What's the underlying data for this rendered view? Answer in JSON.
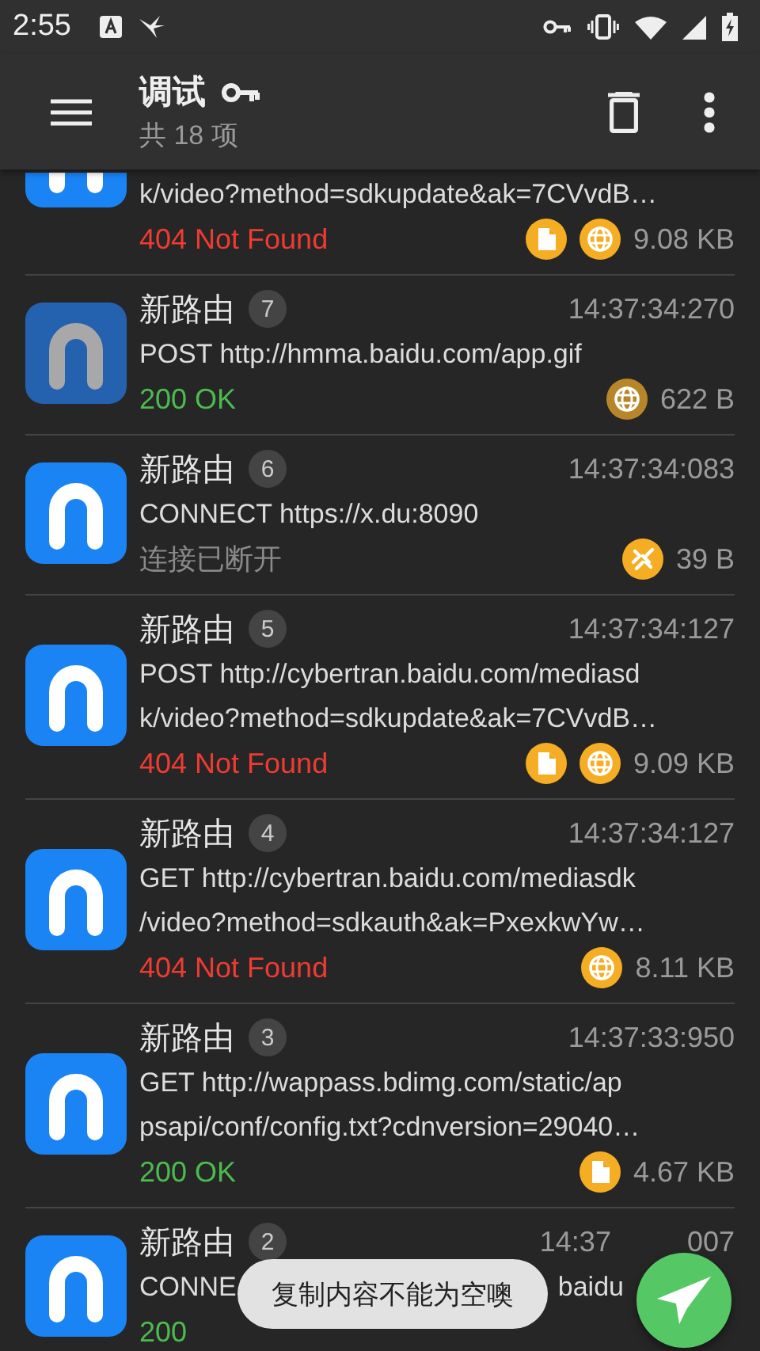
{
  "status_bar": {
    "time": "2:55"
  },
  "app_bar": {
    "title": "调试",
    "subtitle": "共 18 项"
  },
  "requests": [
    {
      "dimmed": false,
      "url_lines": [
        "k/video?method=sdkupdate&ak=7CVvdB…"
      ],
      "status": "404 Not Found",
      "color": "#ef3b32",
      "badges": [
        {
          "kind": "file",
          "dimmed": false
        },
        {
          "kind": "globe",
          "dimmed": false
        }
      ],
      "size": "9.08 KB"
    },
    {
      "dimmed": true,
      "name": "新路由",
      "number": "7",
      "time": "14:37:34:270",
      "url_lines": [
        "POST http://hmma.baidu.com/app.gif"
      ],
      "status": "200 OK",
      "color": "#4cbb4f",
      "badges": [
        {
          "kind": "globe",
          "dimmed": true
        }
      ],
      "size": "622 B"
    },
    {
      "dimmed": false,
      "name": "新路由",
      "number": "6",
      "time": "14:37:34:083",
      "url_lines": [
        "CONNECT https://x.du:8090"
      ],
      "status": "连接已断开",
      "color": "#8a8a8a",
      "badges": [
        {
          "kind": "broken-link",
          "dimmed": false
        }
      ],
      "size": "39 B"
    },
    {
      "dimmed": false,
      "name": "新路由",
      "number": "5",
      "time": "14:37:34:127",
      "url_lines": [
        "POST http://cybertran.baidu.com/mediasd",
        "k/video?method=sdkupdate&ak=7CVvdB…"
      ],
      "status": "404 Not Found",
      "color": "#ef3b32",
      "badges": [
        {
          "kind": "file",
          "dimmed": false
        },
        {
          "kind": "globe",
          "dimmed": false
        }
      ],
      "size": "9.09 KB"
    },
    {
      "dimmed": false,
      "name": "新路由",
      "number": "4",
      "time": "14:37:34:127",
      "url_lines": [
        "GET http://cybertran.baidu.com/mediasdk",
        "/video?method=sdkauth&ak=PxexkwYw…"
      ],
      "status": "404 Not Found",
      "color": "#ef3b32",
      "badges": [
        {
          "kind": "globe",
          "dimmed": false
        }
      ],
      "size": "8.11 KB"
    },
    {
      "dimmed": false,
      "name": "新路由",
      "number": "3",
      "time": "14:37:33:950",
      "url_lines": [
        "GET http://wappass.bdimg.com/static/ap",
        "psapi/conf/config.txt?cdnversion=29040…"
      ],
      "status": "200 OK",
      "color": "#4cbb4f",
      "badges": [
        {
          "kind": "file",
          "dimmed": false
        }
      ],
      "size": "4.67 KB"
    },
    {
      "dimmed": false,
      "name": "新路由",
      "number": "2",
      "time": "14:37",
      "time_tail": "007",
      "url_lines": [
        "CONNE"
      ],
      "url_tail": "baidu",
      "status": "200",
      "color": "#4cbb4f"
    }
  ],
  "toast": {
    "text": "复制内容不能为空噢"
  }
}
